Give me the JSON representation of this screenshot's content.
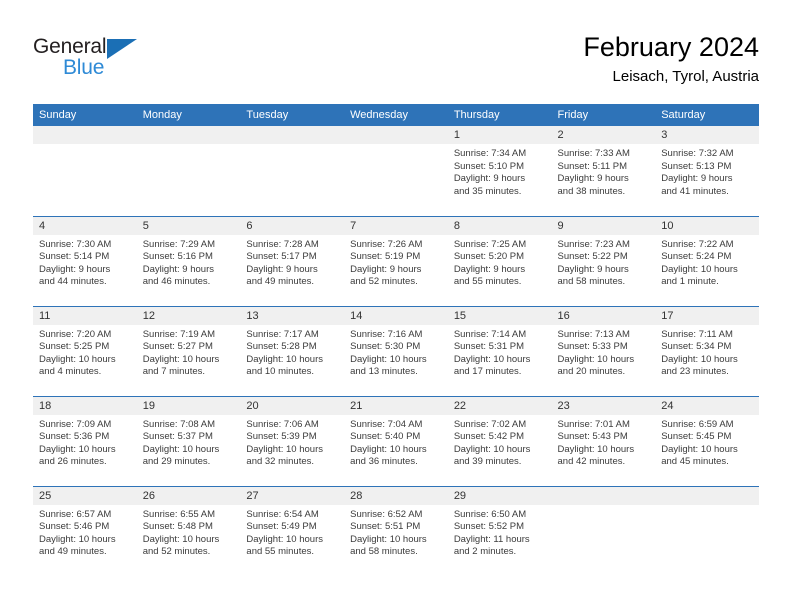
{
  "brand": {
    "name_part1": "General",
    "name_part2": "Blue",
    "triangle_color": "#1b6fb5",
    "blue_color": "#2e8ad6",
    "dark_color": "#231f20"
  },
  "header": {
    "title": "February 2024",
    "location": "Leisach, Tyrol, Austria"
  },
  "theme": {
    "header_bg": "#2e73b8",
    "daynum_bg": "#f0f0f0",
    "row_divider": "#2e73b8",
    "text": "#3b3b3b"
  },
  "weekdays": [
    "Sunday",
    "Monday",
    "Tuesday",
    "Wednesday",
    "Thursday",
    "Friday",
    "Saturday"
  ],
  "labels": {
    "sunrise_prefix": "Sunrise:",
    "sunset_prefix": "Sunset:",
    "daylight_prefix": "Daylight:"
  },
  "weeks": [
    [
      {
        "day": "",
        "lines": []
      },
      {
        "day": "",
        "lines": []
      },
      {
        "day": "",
        "lines": []
      },
      {
        "day": "",
        "lines": []
      },
      {
        "day": "1",
        "lines": [
          "Sunrise: 7:34 AM",
          "Sunset: 5:10 PM",
          "Daylight: 9 hours",
          "and 35 minutes."
        ]
      },
      {
        "day": "2",
        "lines": [
          "Sunrise: 7:33 AM",
          "Sunset: 5:11 PM",
          "Daylight: 9 hours",
          "and 38 minutes."
        ]
      },
      {
        "day": "3",
        "lines": [
          "Sunrise: 7:32 AM",
          "Sunset: 5:13 PM",
          "Daylight: 9 hours",
          "and 41 minutes."
        ]
      }
    ],
    [
      {
        "day": "4",
        "lines": [
          "Sunrise: 7:30 AM",
          "Sunset: 5:14 PM",
          "Daylight: 9 hours",
          "and 44 minutes."
        ]
      },
      {
        "day": "5",
        "lines": [
          "Sunrise: 7:29 AM",
          "Sunset: 5:16 PM",
          "Daylight: 9 hours",
          "and 46 minutes."
        ]
      },
      {
        "day": "6",
        "lines": [
          "Sunrise: 7:28 AM",
          "Sunset: 5:17 PM",
          "Daylight: 9 hours",
          "and 49 minutes."
        ]
      },
      {
        "day": "7",
        "lines": [
          "Sunrise: 7:26 AM",
          "Sunset: 5:19 PM",
          "Daylight: 9 hours",
          "and 52 minutes."
        ]
      },
      {
        "day": "8",
        "lines": [
          "Sunrise: 7:25 AM",
          "Sunset: 5:20 PM",
          "Daylight: 9 hours",
          "and 55 minutes."
        ]
      },
      {
        "day": "9",
        "lines": [
          "Sunrise: 7:23 AM",
          "Sunset: 5:22 PM",
          "Daylight: 9 hours",
          "and 58 minutes."
        ]
      },
      {
        "day": "10",
        "lines": [
          "Sunrise: 7:22 AM",
          "Sunset: 5:24 PM",
          "Daylight: 10 hours",
          "and 1 minute."
        ]
      }
    ],
    [
      {
        "day": "11",
        "lines": [
          "Sunrise: 7:20 AM",
          "Sunset: 5:25 PM",
          "Daylight: 10 hours",
          "and 4 minutes."
        ]
      },
      {
        "day": "12",
        "lines": [
          "Sunrise: 7:19 AM",
          "Sunset: 5:27 PM",
          "Daylight: 10 hours",
          "and 7 minutes."
        ]
      },
      {
        "day": "13",
        "lines": [
          "Sunrise: 7:17 AM",
          "Sunset: 5:28 PM",
          "Daylight: 10 hours",
          "and 10 minutes."
        ]
      },
      {
        "day": "14",
        "lines": [
          "Sunrise: 7:16 AM",
          "Sunset: 5:30 PM",
          "Daylight: 10 hours",
          "and 13 minutes."
        ]
      },
      {
        "day": "15",
        "lines": [
          "Sunrise: 7:14 AM",
          "Sunset: 5:31 PM",
          "Daylight: 10 hours",
          "and 17 minutes."
        ]
      },
      {
        "day": "16",
        "lines": [
          "Sunrise: 7:13 AM",
          "Sunset: 5:33 PM",
          "Daylight: 10 hours",
          "and 20 minutes."
        ]
      },
      {
        "day": "17",
        "lines": [
          "Sunrise: 7:11 AM",
          "Sunset: 5:34 PM",
          "Daylight: 10 hours",
          "and 23 minutes."
        ]
      }
    ],
    [
      {
        "day": "18",
        "lines": [
          "Sunrise: 7:09 AM",
          "Sunset: 5:36 PM",
          "Daylight: 10 hours",
          "and 26 minutes."
        ]
      },
      {
        "day": "19",
        "lines": [
          "Sunrise: 7:08 AM",
          "Sunset: 5:37 PM",
          "Daylight: 10 hours",
          "and 29 minutes."
        ]
      },
      {
        "day": "20",
        "lines": [
          "Sunrise: 7:06 AM",
          "Sunset: 5:39 PM",
          "Daylight: 10 hours",
          "and 32 minutes."
        ]
      },
      {
        "day": "21",
        "lines": [
          "Sunrise: 7:04 AM",
          "Sunset: 5:40 PM",
          "Daylight: 10 hours",
          "and 36 minutes."
        ]
      },
      {
        "day": "22",
        "lines": [
          "Sunrise: 7:02 AM",
          "Sunset: 5:42 PM",
          "Daylight: 10 hours",
          "and 39 minutes."
        ]
      },
      {
        "day": "23",
        "lines": [
          "Sunrise: 7:01 AM",
          "Sunset: 5:43 PM",
          "Daylight: 10 hours",
          "and 42 minutes."
        ]
      },
      {
        "day": "24",
        "lines": [
          "Sunrise: 6:59 AM",
          "Sunset: 5:45 PM",
          "Daylight: 10 hours",
          "and 45 minutes."
        ]
      }
    ],
    [
      {
        "day": "25",
        "lines": [
          "Sunrise: 6:57 AM",
          "Sunset: 5:46 PM",
          "Daylight: 10 hours",
          "and 49 minutes."
        ]
      },
      {
        "day": "26",
        "lines": [
          "Sunrise: 6:55 AM",
          "Sunset: 5:48 PM",
          "Daylight: 10 hours",
          "and 52 minutes."
        ]
      },
      {
        "day": "27",
        "lines": [
          "Sunrise: 6:54 AM",
          "Sunset: 5:49 PM",
          "Daylight: 10 hours",
          "and 55 minutes."
        ]
      },
      {
        "day": "28",
        "lines": [
          "Sunrise: 6:52 AM",
          "Sunset: 5:51 PM",
          "Daylight: 10 hours",
          "and 58 minutes."
        ]
      },
      {
        "day": "29",
        "lines": [
          "Sunrise: 6:50 AM",
          "Sunset: 5:52 PM",
          "Daylight: 11 hours",
          "and 2 minutes."
        ]
      },
      {
        "day": "",
        "lines": []
      },
      {
        "day": "",
        "lines": []
      }
    ]
  ]
}
